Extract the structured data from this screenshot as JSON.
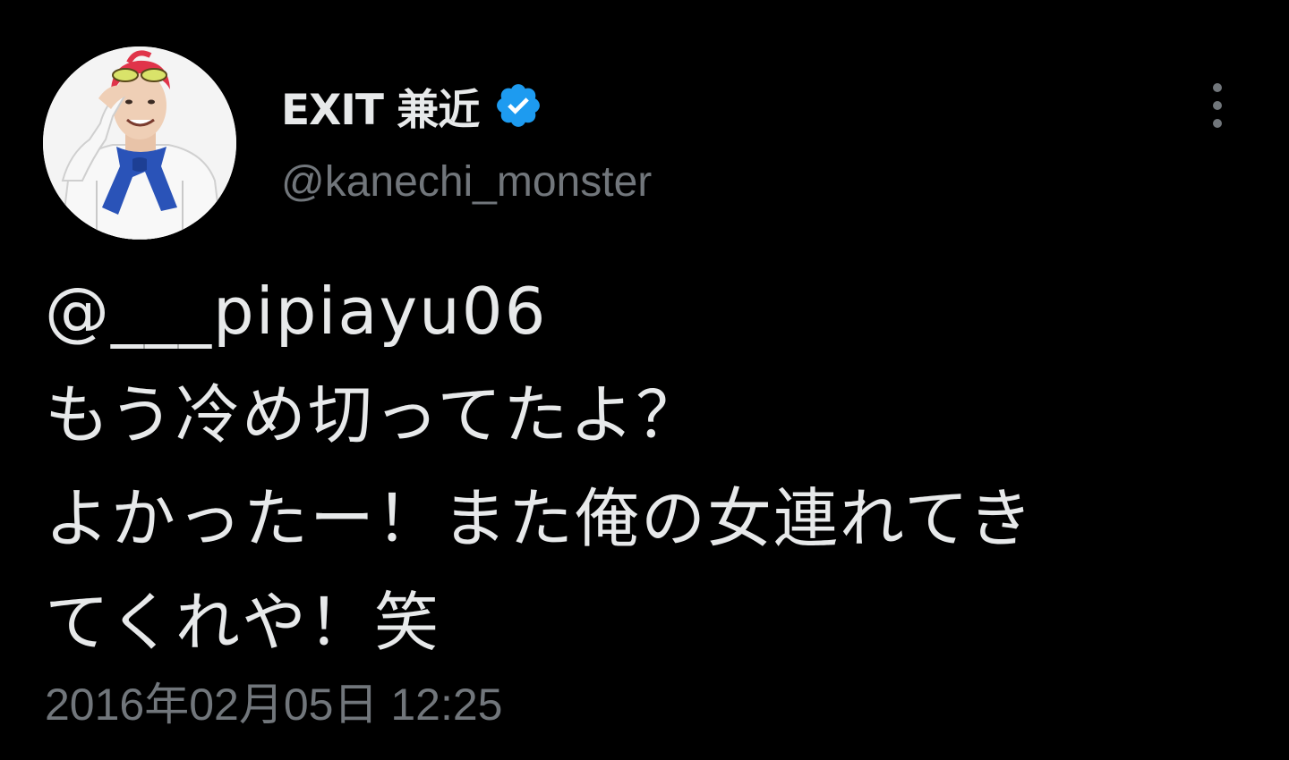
{
  "author": {
    "display_name": "EXIT 兼近",
    "handle": "@kanechi_monster",
    "verified": true,
    "avatar_icon": "profile-photo"
  },
  "tweet": {
    "mention": "@___pipiayu06",
    "lines": [
      "もう冷め切ってたよ？",
      "よかったー！また俺の女連れてき",
      "てくれや！笑"
    ],
    "timestamp": "2016年02月05日 12:25"
  },
  "icons": {
    "verified": "verified-badge-icon",
    "more": "more-options-icon"
  },
  "colors": {
    "background": "#000000",
    "text_primary": "#e7e9ea",
    "text_secondary": "#71767b",
    "verified_blue": "#1d9bf0"
  }
}
